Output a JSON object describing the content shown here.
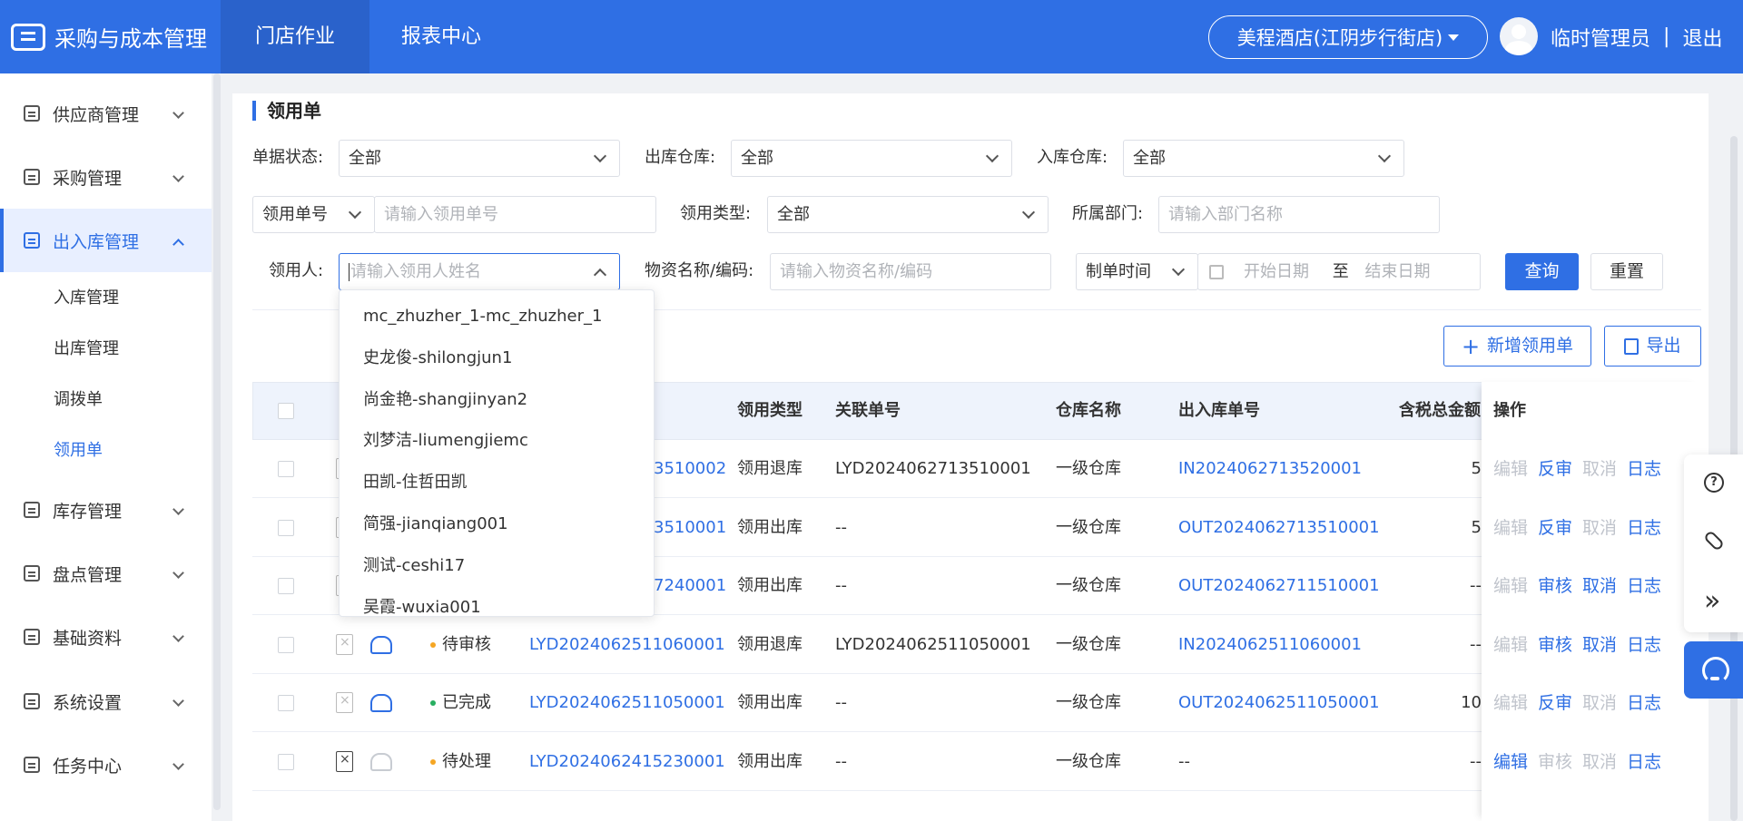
{
  "header": {
    "app_title": "采购与成本管理",
    "nav": [
      "门店作业",
      "报表中心"
    ],
    "store": "美程酒店(江阴步行街店)",
    "user": "临时管理员",
    "separator": "|",
    "logout": "退出"
  },
  "sidebar": {
    "menu": [
      "供应商管理",
      "采购管理",
      "出入库管理",
      "库存管理",
      "盘点管理",
      "基础资料",
      "系统设置",
      "任务中心"
    ],
    "submenu": [
      "入库管理",
      "出库管理",
      "调拨单",
      "领用单"
    ]
  },
  "page": {
    "title": "领用单",
    "filters": {
      "status_label": "单据状态:",
      "status_value": "全部",
      "out_wh_label": "出库仓库:",
      "out_wh_value": "全部",
      "in_wh_label": "入库仓库:",
      "in_wh_value": "全部",
      "no_type_value": "领用单号",
      "no_placeholder": "请输入领用单号",
      "type_label": "领用类型:",
      "type_value": "全部",
      "dept_label": "所属部门:",
      "dept_placeholder": "请输入部门名称",
      "person_label": "领用人:",
      "person_placeholder": "请输入领用人姓名",
      "material_label": "物资名称/编码:",
      "material_placeholder": "请输入物资名称/编码",
      "time_type_value": "制单时间",
      "start_placeholder": "开始日期",
      "range_sep": "至",
      "end_placeholder": "结束日期",
      "query": "查询",
      "reset": "重置"
    },
    "actions": {
      "add": "新增领用单",
      "add_icon": "+",
      "export": "导出"
    }
  },
  "table": {
    "headers": {
      "col_status_partial": "",
      "type": "领用类型",
      "related": "关联单号",
      "warehouse": "仓库名称",
      "io_no": "出入库单号",
      "amount": "含税总金额",
      "ops": "操作"
    },
    "rows": [
      {
        "status": "",
        "no": "3510002",
        "type": "领用退库",
        "related": "LYD2024062713510001",
        "warehouse": "一级仓库",
        "io": "IN2024062713520001",
        "amount": "5",
        "ops": [
          "编辑",
          "反审",
          "取消",
          "日志"
        ]
      },
      {
        "status": "",
        "no": "3510001",
        "type": "领用出库",
        "related": "--",
        "warehouse": "一级仓库",
        "io": "OUT2024062713510001",
        "amount": "5",
        "ops": [
          "编辑",
          "反审",
          "取消",
          "日志"
        ]
      },
      {
        "status": "",
        "no": "7240001",
        "type": "领用出库",
        "related": "--",
        "warehouse": "一级仓库",
        "io": "OUT2024062711510001",
        "amount": "--",
        "ops": [
          "编辑",
          "审核",
          "取消",
          "日志"
        ]
      },
      {
        "status": "待审核",
        "no": "LYD2024062511060001",
        "type": "领用退库",
        "related": "LYD2024062511050001",
        "warehouse": "一级仓库",
        "io": "IN2024062511060001",
        "amount": "--",
        "ops": [
          "编辑",
          "审核",
          "取消",
          "日志"
        ]
      },
      {
        "status": "已完成",
        "no": "LYD2024062511050001",
        "type": "领用出库",
        "related": "--",
        "warehouse": "一级仓库",
        "io": "OUT2024062511050001",
        "amount": "10",
        "ops": [
          "编辑",
          "反审",
          "取消",
          "日志"
        ]
      },
      {
        "status": "待处理",
        "no": "LYD2024062415230001",
        "type": "领用出库",
        "related": "--",
        "warehouse": "一级仓库",
        "io": "--",
        "amount": "--",
        "ops": [
          "编辑",
          "审核",
          "取消",
          "日志"
        ]
      }
    ],
    "status_colors": {
      "待审核": "#f5a623",
      "已完成": "#27ae60",
      "待处理": "#f5a623"
    }
  },
  "dropdown": {
    "options": [
      "mc_zhuzher_1-mc_zhuzher_1",
      "史龙俊-shilongjun1",
      "尚金艳-shangjinyan2",
      "刘梦洁-liumengjiemc",
      "田凯-住哲田凯",
      "简强-jianqiang001",
      "测试-ceshi17",
      "吴霞-wuxia001"
    ]
  },
  "float_tools": {
    "help": "?",
    "expand": "»"
  },
  "colors": {
    "primary": "#2f6fe4",
    "header_active": "#2a62cb"
  }
}
